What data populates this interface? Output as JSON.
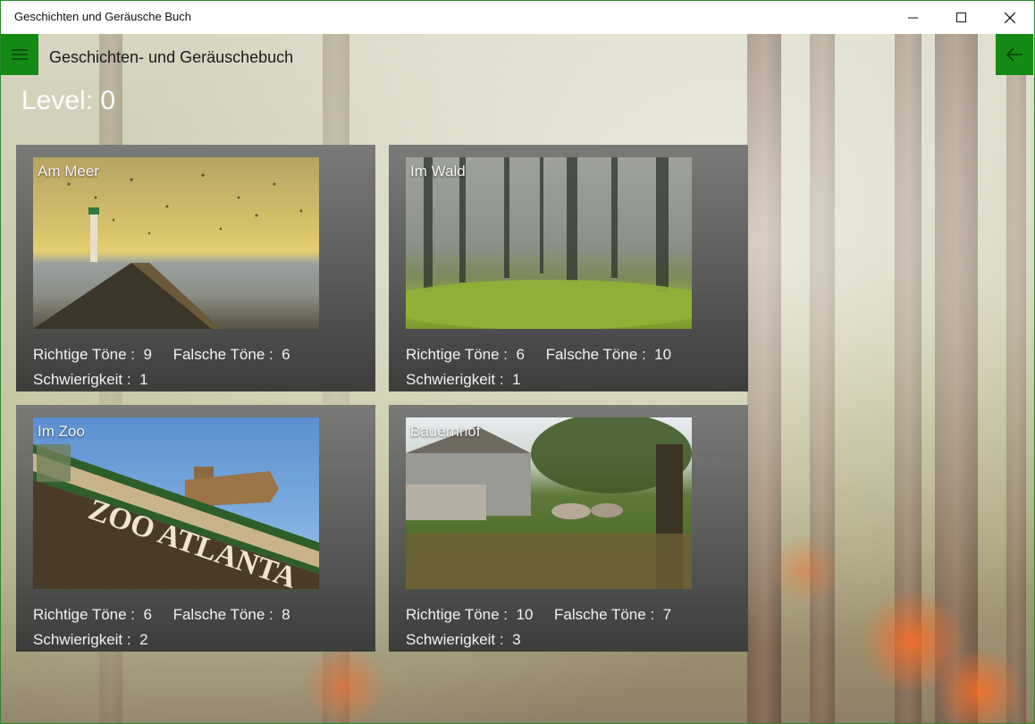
{
  "window": {
    "title": "Geschichten und Geräusche Buch"
  },
  "appbar": {
    "title": "Geschichten- und Geräuschebuch"
  },
  "level": {
    "text": "Level: 0"
  },
  "labels": {
    "correct": "Richtige Töne :",
    "wrong": "Falsche Töne :",
    "difficulty": "Schwierigkeit :"
  },
  "cards": [
    {
      "name": "Am Meer",
      "correct": "9",
      "wrong": "6",
      "difficulty": "1"
    },
    {
      "name": "Im Wald",
      "correct": "6",
      "wrong": "10",
      "difficulty": "1"
    },
    {
      "name": "Im Zoo",
      "correct": "6",
      "wrong": "8",
      "difficulty": "2"
    },
    {
      "name": "Bauernhof",
      "correct": "10",
      "wrong": "7",
      "difficulty": "3"
    }
  ],
  "images": {
    "zoo_sign": "ZOO ATLANTA"
  },
  "colors": {
    "accent": "#148a14"
  }
}
